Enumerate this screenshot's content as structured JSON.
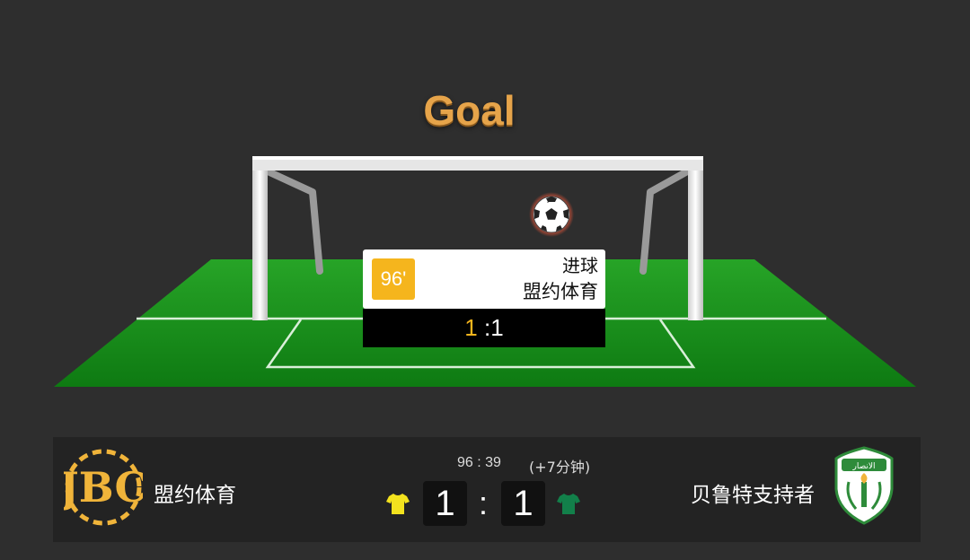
{
  "event_banner": {
    "title": "Goal"
  },
  "event_card": {
    "minute": "96'",
    "type": "进球",
    "team": "盟约体育",
    "home_score": "1",
    "away_score": ":1"
  },
  "scoreboard": {
    "clock": "96 : 39",
    "added_time": "(+7分钟)",
    "home": {
      "name": "盟约体育",
      "score": "1",
      "jersey_color": "#f3e21e",
      "logo_color": "#f0b43a"
    },
    "away": {
      "name": "贝鲁特支持者",
      "score": "1",
      "jersey_color": "#12804a",
      "logo_color": "#2e8b3a",
      "logo_text": "الانصار"
    },
    "separator": ":"
  },
  "colors": {
    "accent": "#f5b51d",
    "pitch": "#1f9a1f",
    "background": "#2e2e2e"
  },
  "icons": [
    "soccer-ball-icon",
    "home-jersey-icon",
    "away-jersey-icon",
    "home-team-logo",
    "away-team-logo"
  ]
}
